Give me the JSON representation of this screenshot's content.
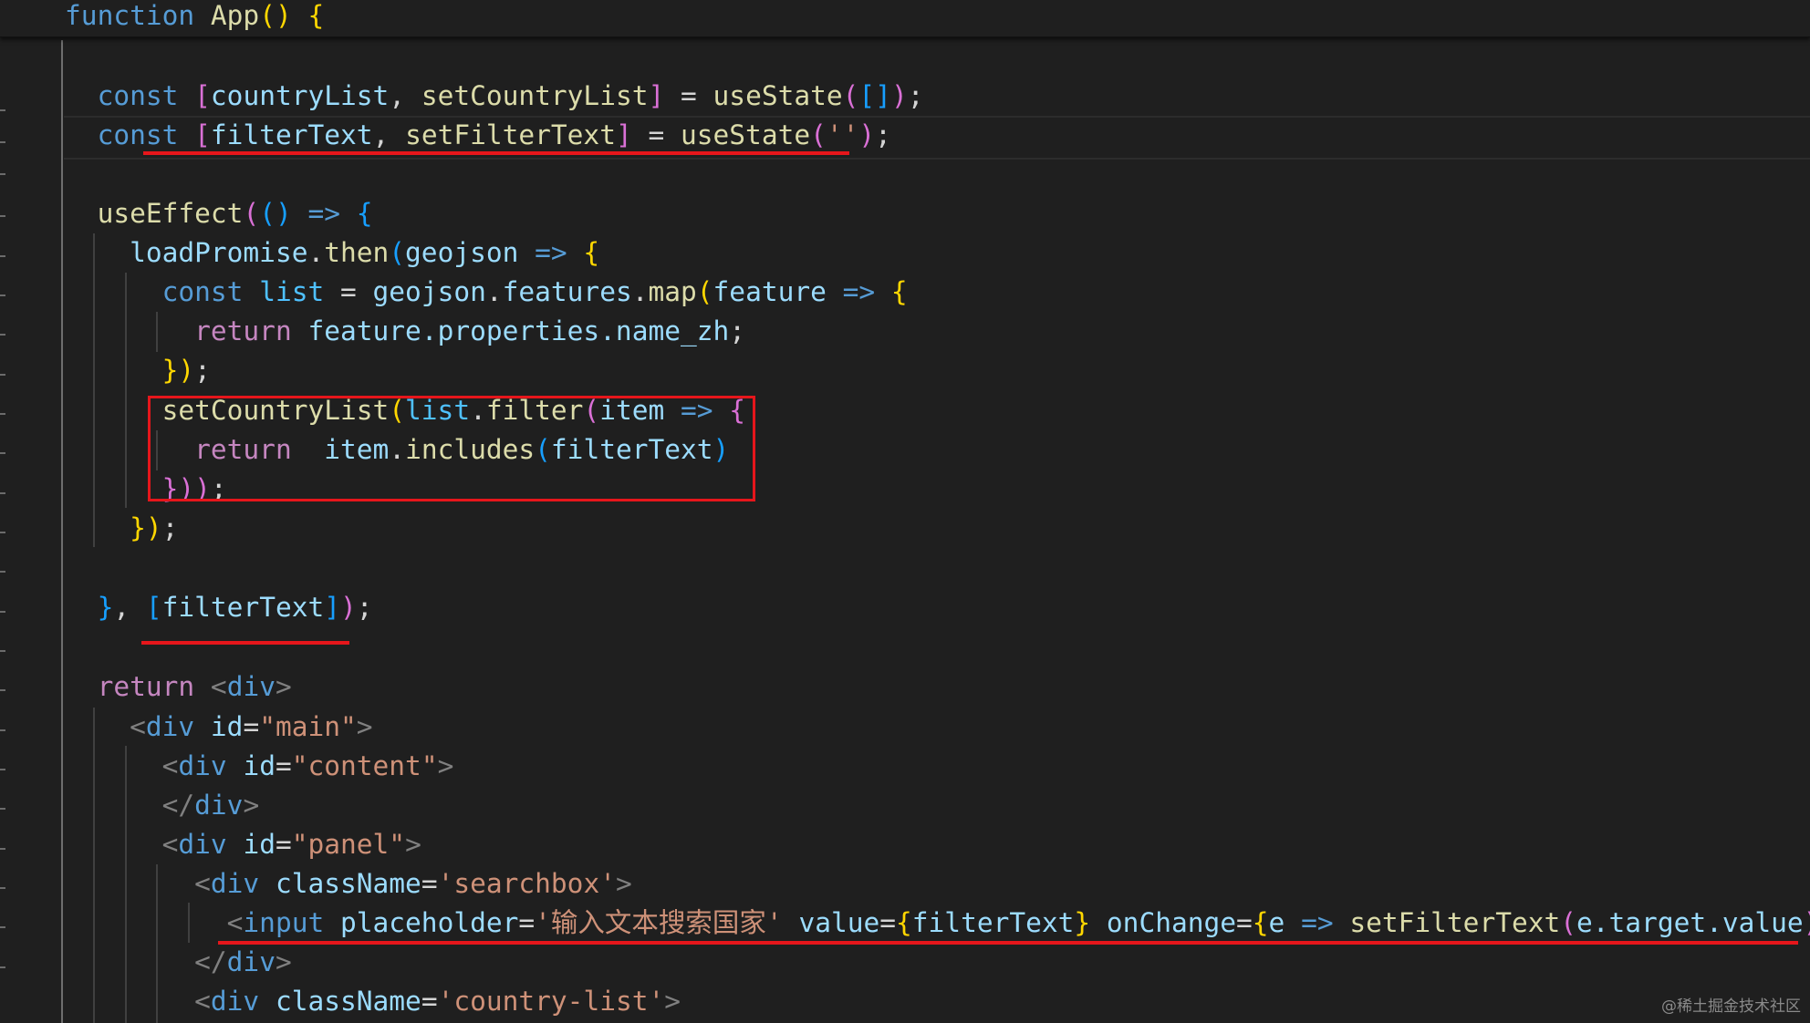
{
  "header": {
    "kw": "function",
    "name": "App",
    "open": "() {"
  },
  "code": {
    "l1": {
      "kw": "const",
      "o": "[",
      "a": "countryList",
      "cm": ",",
      "b": "setCountryList",
      "c": "]",
      "eq": " = ",
      "fn": "useState",
      "p1": "(",
      "arr": "[]",
      "p2": ")",
      "semi": ";"
    },
    "l2": {
      "kw": "const",
      "o": "[",
      "a": "filterText",
      "cm": ",",
      "b": "setFilterText",
      "c": "]",
      "eq": " = ",
      "fn": "useState",
      "p1": "(",
      "str": "''",
      "p2": ")",
      "semi": ";"
    },
    "l3": {
      "fn": "useEffect",
      "p1": "(",
      "p2": "()",
      "arrow": " => ",
      "brace": "{"
    },
    "l4": {
      "obj": "loadPromise",
      "dot": ".",
      "fn": "then",
      "p1": "(",
      "arg": "geojson",
      "arrow": " => ",
      "brace": "{"
    },
    "l5": {
      "kw": "const",
      "var": "list",
      "eq": " = ",
      "obj": "geojson",
      "dot1": ".",
      "prop": "features",
      "dot2": ".",
      "fn": "map",
      "p1": "(",
      "arg": "feature",
      "arrow": " => ",
      "brace": "{"
    },
    "l6": {
      "kw": "return",
      "expr": "feature.properties.name_zh",
      "semi": ";"
    },
    "l7": {
      "close": "})",
      "semi": ";"
    },
    "l8": {
      "fn": "setCountryList",
      "p1": "(",
      "obj": "list",
      "dot": ".",
      "fn2": "filter",
      "p2": "(",
      "arg": "item",
      "arrow": " => ",
      "brace": "{"
    },
    "l9": {
      "kw": "return",
      "obj": "item",
      "dot": ".",
      "fn": "includes",
      "p1": "(",
      "arg": "filterText",
      "p2": ")"
    },
    "l10": {
      "close": "}))",
      "semi": ";"
    },
    "l11": {
      "close": "})",
      "semi": ";"
    },
    "l12": {
      "brace": "}",
      "cm": ", ",
      "o": "[",
      "arg": "filterText",
      "c": "]",
      "p": ")",
      "semi": ";"
    },
    "l13": {
      "kw": "return",
      "tag": "div"
    },
    "l14": {
      "tag": "div",
      "attr": "id",
      "eq": "=",
      "val": "\"main\""
    },
    "l15": {
      "tag": "div",
      "attr": "id",
      "eq": "=",
      "val": "\"content\""
    },
    "l16": {
      "tag": "div"
    },
    "l17": {
      "tag": "div",
      "attr": "id",
      "eq": "=",
      "val": "\"panel\""
    },
    "l18": {
      "tag": "div",
      "attr": "className",
      "eq": "=",
      "val": "'searchbox'"
    },
    "l19": {
      "tag": "input",
      "attr1": "placeholder",
      "val1": "'输入文本搜索国家'",
      "attr2": "value",
      "v2": "filterText",
      "attr3": "onChange",
      "arg": "e",
      "arrow": " => ",
      "fn": "setFilterText",
      "expr": "e.target.value",
      "tail": "/"
    },
    "l20": {
      "tag": "div"
    },
    "l21": {
      "tag": "div",
      "attr": "className",
      "eq": "=",
      "val": "'country-list'"
    }
  },
  "annotation_color": "#e6161b",
  "watermark": "@稀土掘金技术社区"
}
